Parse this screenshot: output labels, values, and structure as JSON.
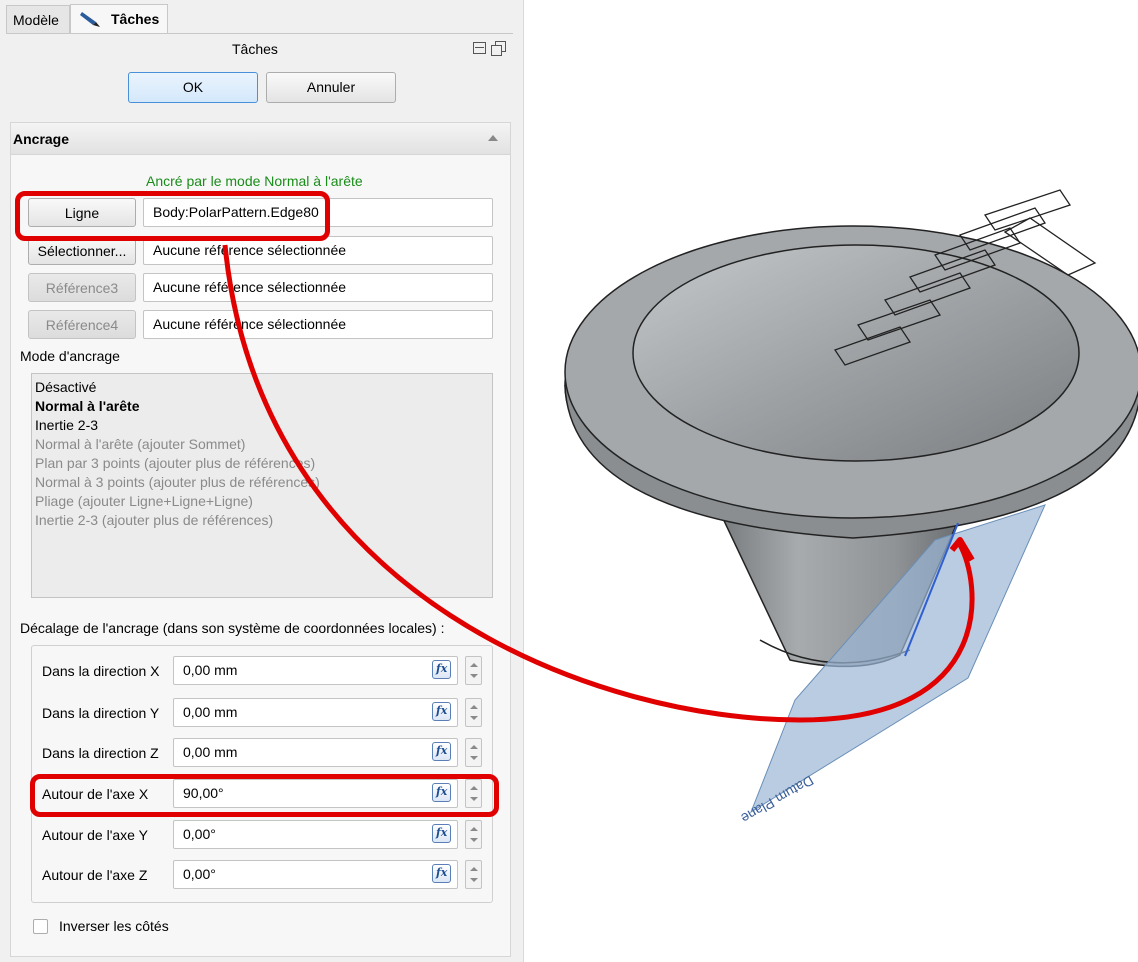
{
  "tabs": {
    "model": "Modèle",
    "tasks": "Tâches"
  },
  "panel_title": "Tâches",
  "buttons": {
    "ok": "OK",
    "cancel": "Annuler"
  },
  "section": {
    "title": "Ancrage"
  },
  "attached_status": "Ancré par le mode Normal à l'arête",
  "refs": [
    {
      "button": "Ligne",
      "value": "Body:PolarPattern.Edge80"
    },
    {
      "button": "Sélectionner...",
      "value": "Aucune référence sélectionnée"
    },
    {
      "button": "Référence3",
      "value": "Aucune référence sélectionnée"
    },
    {
      "button": "Référence4",
      "value": "Aucune référence sélectionnée"
    }
  ],
  "mode_label": "Mode d'ancrage",
  "modes": [
    "Désactivé",
    "Normal à l'arête",
    "Inertie 2-3",
    "Normal à l'arête (ajouter Sommet)",
    "Plan par 3 points (ajouter plus de références)",
    "Normal à 3 points (ajouter plus de références)",
    "Pliage (ajouter Ligne+Ligne+Ligne)",
    "Inertie 2-3 (ajouter plus de références)"
  ],
  "offset_label": "Décalage de l'ancrage (dans son système de coordonnées locales) :",
  "offsets": [
    {
      "label": "Dans la direction X",
      "value": "0,00 mm"
    },
    {
      "label": "Dans la direction Y",
      "value": "0,00 mm"
    },
    {
      "label": "Dans la direction Z",
      "value": "0,00 mm"
    },
    {
      "label": "Autour de l'axe X",
      "value": "90,00°"
    },
    {
      "label": "Autour de l'axe Y",
      "value": "0,00°"
    },
    {
      "label": "Autour de l'axe Z",
      "value": "0,00°"
    }
  ],
  "flip_label": "Inverser les côtés",
  "viewport": {
    "plane_label": "Datum Plane"
  },
  "colors": {
    "status_green": "#1a8c1a",
    "highlight_red": "#e00000",
    "plane_blue": "#9bb7d6",
    "model_gray": "#8f9396"
  }
}
